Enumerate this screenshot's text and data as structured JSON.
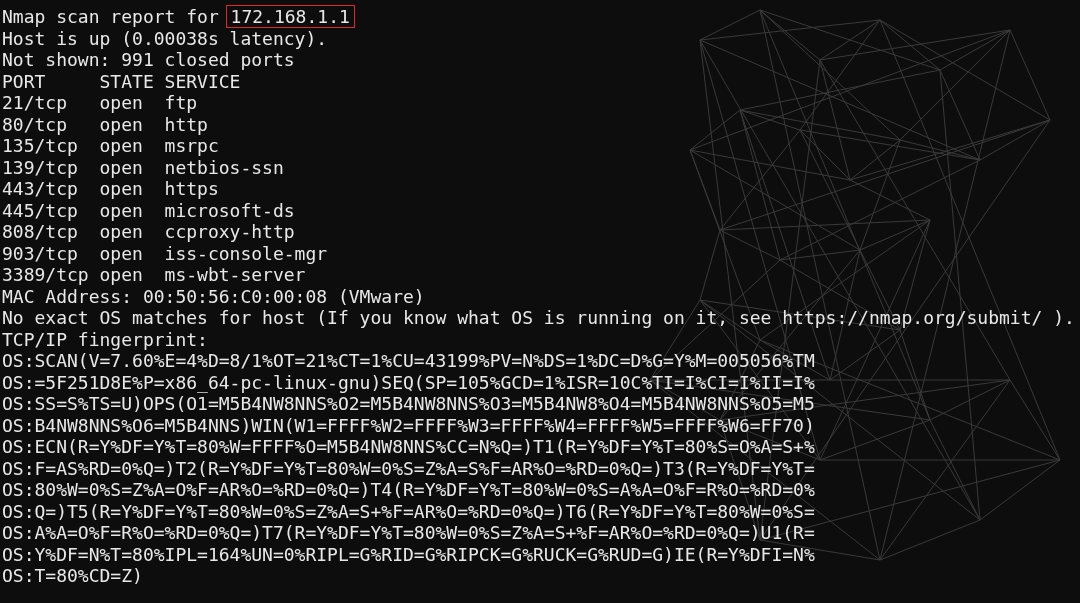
{
  "report": {
    "label": "Nmap scan report for",
    "host": "172.168.1.1",
    "host_highlighted": true
  },
  "status_lines": [
    "Host is up (0.00038s latency).",
    "Not shown: 991 closed ports"
  ],
  "ports": {
    "columns": [
      "PORT",
      "STATE",
      "SERVICE"
    ],
    "rows": [
      [
        "21/tcp",
        "open",
        "ftp"
      ],
      [
        "80/tcp",
        "open",
        "http"
      ],
      [
        "135/tcp",
        "open",
        "msrpc"
      ],
      [
        "139/tcp",
        "open",
        "netbios-ssn"
      ],
      [
        "443/tcp",
        "open",
        "https"
      ],
      [
        "445/tcp",
        "open",
        "microsoft-ds"
      ],
      [
        "808/tcp",
        "open",
        "ccproxy-http"
      ],
      [
        "903/tcp",
        "open",
        "iss-console-mgr"
      ],
      [
        "3389/tcp",
        "open",
        "ms-wbt-server"
      ]
    ]
  },
  "info_lines": [
    "MAC Address: 00:50:56:C0:00:08 (VMware)",
    "No exact OS matches for host (If you know what OS is running on it, see https://nmap.org/submit/ ).",
    "TCP/IP fingerprint:"
  ],
  "fingerprint_lines": [
    "OS:SCAN(V=7.60%E=4%D=8/1%OT=21%CT=1%CU=43199%PV=N%DS=1%DC=D%G=Y%M=005056%TM",
    "OS:=5F251D8E%P=x86_64-pc-linux-gnu)SEQ(SP=105%GCD=1%ISR=10C%TI=I%CI=I%II=I%",
    "OS:SS=S%TS=U)OPS(O1=M5B4NW8NNS%O2=M5B4NW8NNS%O3=M5B4NW8%O4=M5B4NW8NNS%O5=M5",
    "OS:B4NW8NNS%O6=M5B4NNS)WIN(W1=FFFF%W2=FFFF%W3=FFFF%W4=FFFF%W5=FFFF%W6=FF70)",
    "OS:ECN(R=Y%DF=Y%T=80%W=FFFF%O=M5B4NW8NNS%CC=N%Q=)T1(R=Y%DF=Y%T=80%S=O%A=S+%",
    "OS:F=AS%RD=0%Q=)T2(R=Y%DF=Y%T=80%W=0%S=Z%A=S%F=AR%O=%RD=0%Q=)T3(R=Y%DF=Y%T=",
    "OS:80%W=0%S=Z%A=O%F=AR%O=%RD=0%Q=)T4(R=Y%DF=Y%T=80%W=0%S=A%A=O%F=R%O=%RD=0%",
    "OS:Q=)T5(R=Y%DF=Y%T=80%W=0%S=Z%A=S+%F=AR%O=%RD=0%Q=)T6(R=Y%DF=Y%T=80%W=0%S=",
    "OS:A%A=O%F=R%O=%RD=0%Q=)T7(R=Y%DF=Y%T=80%W=0%S=Z%A=S+%F=AR%O=%RD=0%Q=)U1(R=",
    "OS:Y%DF=N%T=80%IPL=164%UN=0%RIPL=G%RID=G%RIPCK=G%RUCK=G%RUD=G)IE(R=Y%DFI=N%",
    "OS:T=80%CD=Z)"
  ]
}
